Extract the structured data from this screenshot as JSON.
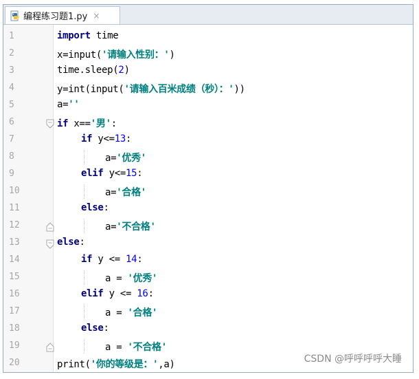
{
  "tab": {
    "title": "编程练习题1.py",
    "close_glyph": "×",
    "icon": "python-file-icon"
  },
  "lines": [
    {
      "n": "1",
      "segs": [
        {
          "t": "import",
          "c": "kw"
        },
        {
          "t": " time",
          "c": ""
        }
      ]
    },
    {
      "n": "2",
      "segs": [
        {
          "t": "x=input(",
          "c": ""
        },
        {
          "t": "'请输入性别：'",
          "c": "str"
        },
        {
          "t": ")",
          "c": ""
        }
      ]
    },
    {
      "n": "3",
      "segs": [
        {
          "t": "time.sleep(",
          "c": ""
        },
        {
          "t": "2",
          "c": "num"
        },
        {
          "t": ")",
          "c": ""
        }
      ]
    },
    {
      "n": "4",
      "segs": [
        {
          "t": "y=int(input(",
          "c": ""
        },
        {
          "t": "'请输入百米成绩（秒）：'",
          "c": "str"
        },
        {
          "t": "))",
          "c": ""
        }
      ]
    },
    {
      "n": "5",
      "segs": [
        {
          "t": "a=",
          "c": ""
        },
        {
          "t": "''",
          "c": "str"
        }
      ]
    },
    {
      "n": "6",
      "segs": [
        {
          "t": "if",
          "c": "kw"
        },
        {
          "t": " x==",
          "c": ""
        },
        {
          "t": "'男'",
          "c": "str"
        },
        {
          "t": ":",
          "c": ""
        }
      ]
    },
    {
      "n": "7",
      "segs": [
        {
          "t": "if",
          "c": "kw"
        },
        {
          "t": " y<=",
          "c": ""
        },
        {
          "t": "13",
          "c": "num"
        },
        {
          "t": ":",
          "c": ""
        }
      ]
    },
    {
      "n": "8",
      "segs": [
        {
          "t": "a=",
          "c": ""
        },
        {
          "t": "'优秀'",
          "c": "str"
        }
      ]
    },
    {
      "n": "9",
      "segs": [
        {
          "t": "elif",
          "c": "kw"
        },
        {
          "t": " y<=",
          "c": ""
        },
        {
          "t": "15",
          "c": "num"
        },
        {
          "t": ":",
          "c": ""
        }
      ]
    },
    {
      "n": "10",
      "segs": [
        {
          "t": "a=",
          "c": ""
        },
        {
          "t": "'合格'",
          "c": "str"
        }
      ]
    },
    {
      "n": "11",
      "segs": [
        {
          "t": "else",
          "c": "kw"
        },
        {
          "t": ":",
          "c": ""
        }
      ]
    },
    {
      "n": "12",
      "segs": [
        {
          "t": "a=",
          "c": ""
        },
        {
          "t": "'不合格'",
          "c": "str"
        }
      ]
    },
    {
      "n": "13",
      "segs": [
        {
          "t": "else",
          "c": "kw"
        },
        {
          "t": ":",
          "c": ""
        }
      ]
    },
    {
      "n": "14",
      "segs": [
        {
          "t": "if",
          "c": "kw"
        },
        {
          "t": " y <= ",
          "c": ""
        },
        {
          "t": "14",
          "c": "num"
        },
        {
          "t": ":",
          "c": ""
        }
      ]
    },
    {
      "n": "15",
      "segs": [
        {
          "t": "a = ",
          "c": ""
        },
        {
          "t": "'优秀'",
          "c": "str"
        }
      ]
    },
    {
      "n": "16",
      "segs": [
        {
          "t": "elif",
          "c": "kw"
        },
        {
          "t": " y <= ",
          "c": ""
        },
        {
          "t": "16",
          "c": "num"
        },
        {
          "t": ":",
          "c": ""
        }
      ]
    },
    {
      "n": "17",
      "segs": [
        {
          "t": "a = ",
          "c": ""
        },
        {
          "t": "'合格'",
          "c": "str"
        }
      ]
    },
    {
      "n": "18",
      "segs": [
        {
          "t": "else",
          "c": "kw"
        },
        {
          "t": ":",
          "c": ""
        }
      ]
    },
    {
      "n": "19",
      "segs": [
        {
          "t": "a = ",
          "c": ""
        },
        {
          "t": "'不合格'",
          "c": "str"
        }
      ]
    },
    {
      "n": "20",
      "segs": [
        {
          "t": "print(",
          "c": ""
        },
        {
          "t": "'你的等级是：'",
          "c": "str"
        },
        {
          "t": ",a)",
          "c": ""
        }
      ]
    }
  ],
  "watermark": "CSDN @呼呼呼呼大睡",
  "colors": {
    "keyword": "#000080",
    "string": "#008080",
    "number": "#0000ff",
    "line_number": "#a6a6a6"
  }
}
